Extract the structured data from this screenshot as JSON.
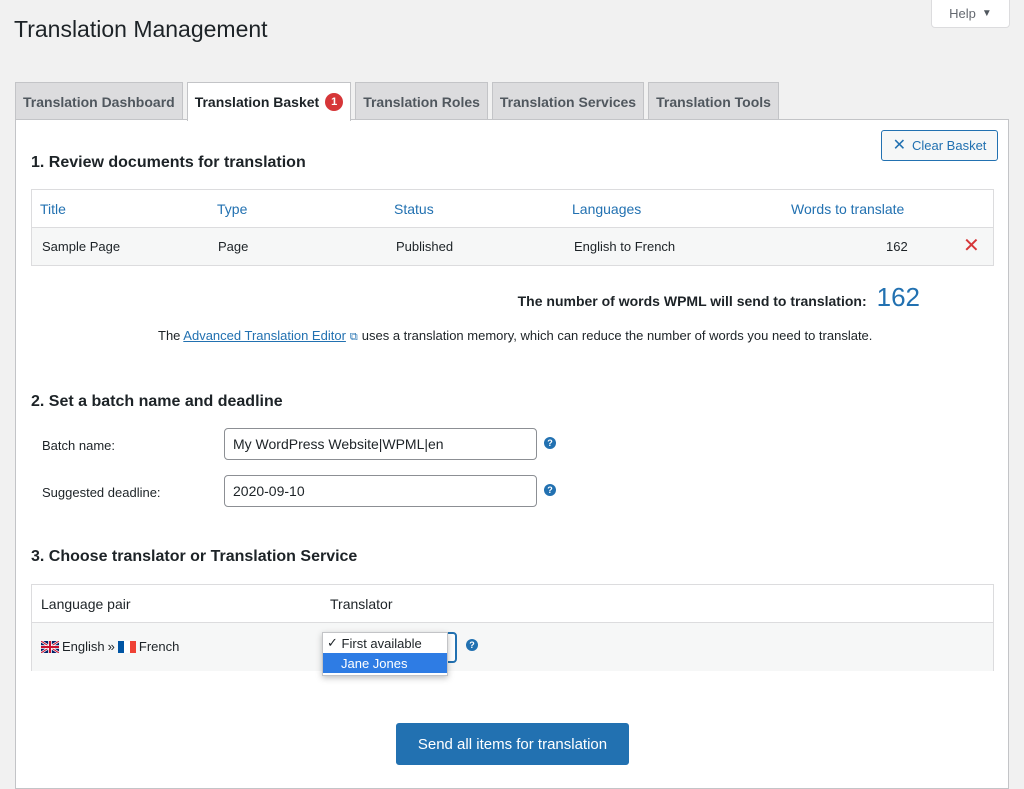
{
  "header": {
    "title": "Translation Management",
    "help_label": "Help",
    "help_caret": "▼"
  },
  "tabs": [
    {
      "label": "Translation Dashboard",
      "active": false
    },
    {
      "label": "Translation Basket",
      "active": true,
      "badge": "1"
    },
    {
      "label": "Translation Roles",
      "active": false
    },
    {
      "label": "Translation Services",
      "active": false
    },
    {
      "label": "Translation Tools",
      "active": false
    }
  ],
  "clear_basket": {
    "icon": "close-icon",
    "label": "Clear Basket"
  },
  "section1": {
    "heading": "1. Review documents for translation",
    "columns": [
      "Title",
      "Type",
      "Status",
      "Languages",
      "Words to translate"
    ],
    "rows": [
      {
        "title": "Sample Page",
        "type": "Page",
        "status": "Published",
        "languages": "English to French",
        "words": "162",
        "remove_icon": "remove-icon"
      }
    ],
    "word_count_label": "The number of words WPML will send to translation:",
    "word_count_value": "162",
    "ate_prefix": "The ",
    "ate_link": "Advanced Translation Editor",
    "ate_suffix": "uses a translation memory, which can reduce the number of words you need to translate."
  },
  "section2": {
    "heading": "2. Set a batch name and deadline",
    "batch_label": "Batch name:",
    "batch_value": "My WordPress Website|WPML|en",
    "deadline_label": "Suggested deadline:",
    "deadline_value": "2020-09-10"
  },
  "section3": {
    "heading": "3. Choose translator or Translation Service",
    "columns": [
      "Language pair",
      "Translator"
    ],
    "row": {
      "from": "English",
      "separator": "»",
      "to": "French"
    },
    "translator_options": [
      {
        "label": "First available",
        "selected": true,
        "checkmark": "✓"
      },
      {
        "label": "Jane Jones",
        "selected": false
      }
    ]
  },
  "send_button": "Send all items for translation",
  "colors": {
    "accent": "#2271b1",
    "danger": "#d63638",
    "badge": "#d63638"
  }
}
